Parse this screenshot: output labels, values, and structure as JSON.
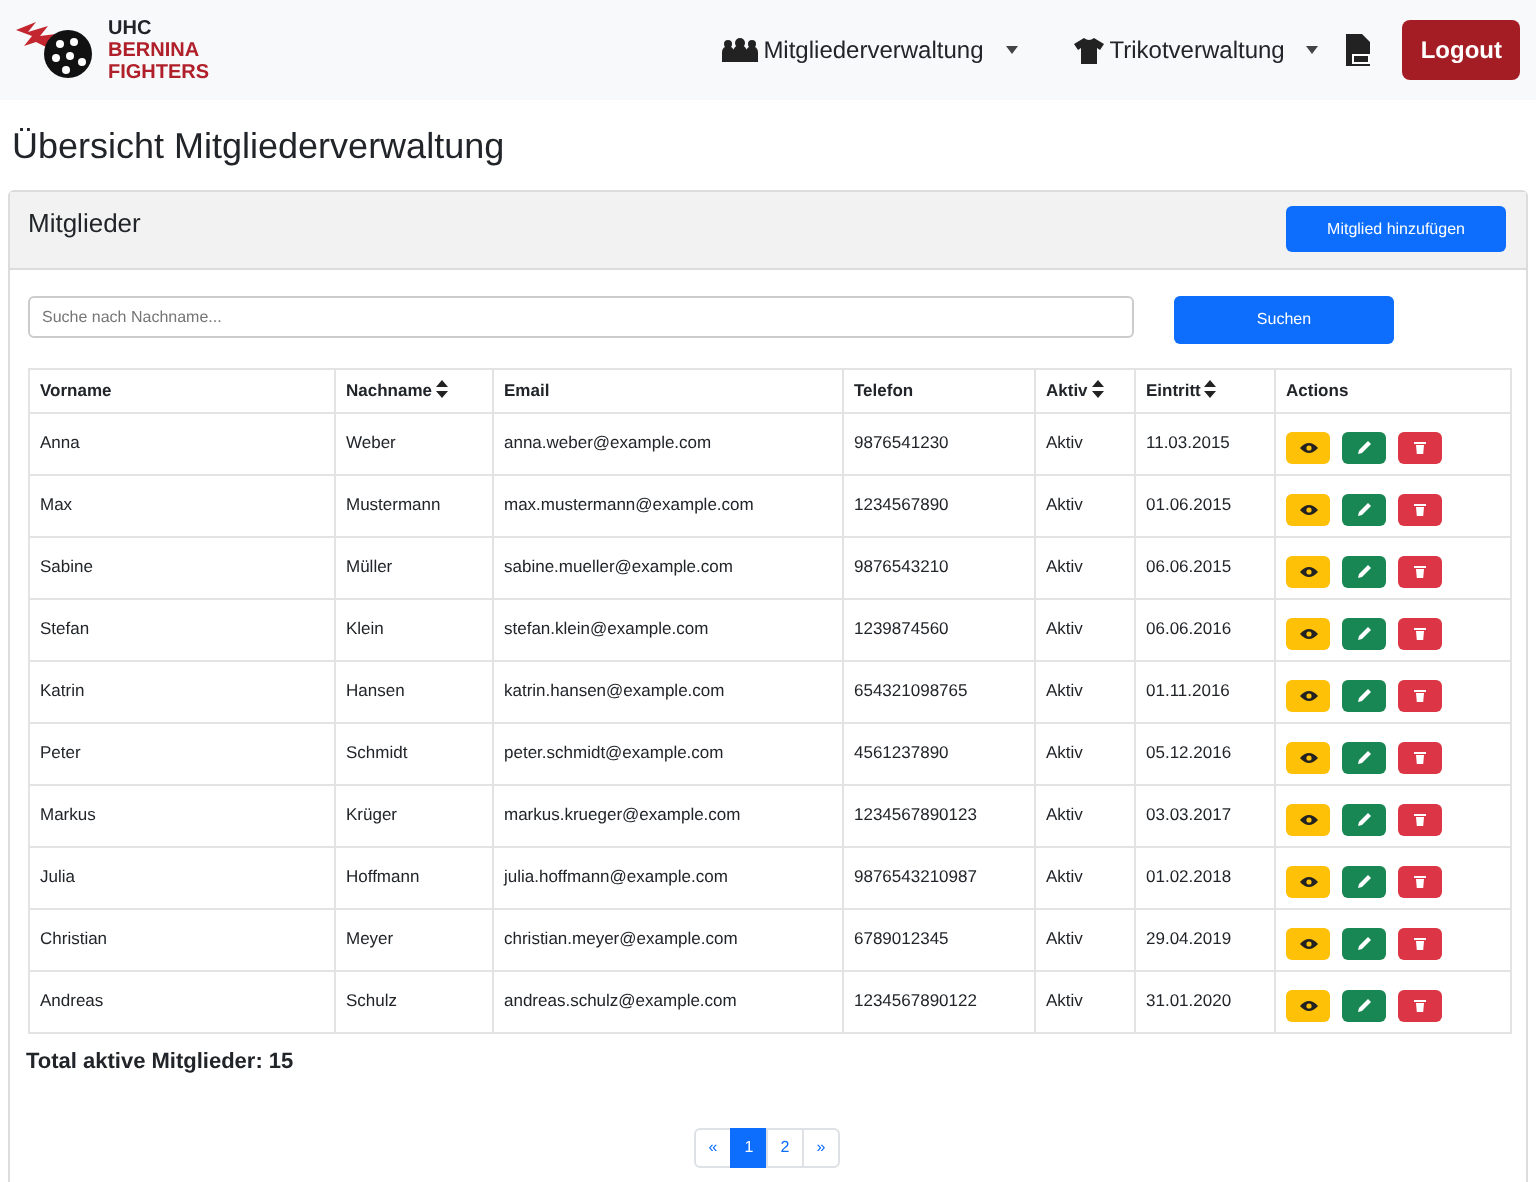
{
  "brand": {
    "line_1": "UHC",
    "line_2": "BERNINA",
    "line_3": "FIGHTERS"
  },
  "nav": [
    {
      "label": "Mitgliederverwaltung",
      "kind": "members"
    },
    {
      "label": "Trikotverwaltung",
      "kind": "shirt"
    }
  ],
  "logout": "Logout",
  "page_title": "Übersicht Mitgliederverwaltung",
  "card": {
    "title": "Mitglieder",
    "add_button": "Mitglied hinzufügen"
  },
  "search": {
    "placeholder": "Suche nach Nachname...",
    "button": "Suchen"
  },
  "table": {
    "columns": [
      {
        "label": "Vorname",
        "sortable": false
      },
      {
        "label": "Nachname",
        "sortable": true
      },
      {
        "label": "Email",
        "sortable": false
      },
      {
        "label": "Telefon",
        "sortable": false
      },
      {
        "label": "Aktiv",
        "sortable": true
      },
      {
        "label": "Eintritt",
        "sortable": true
      },
      {
        "label": "Actions",
        "sortable": false
      }
    ],
    "rows": [
      [
        "Anna",
        "Weber",
        "anna.weber@example.com",
        "9876541230",
        "Aktiv",
        "11.03.2015"
      ],
      [
        "Max",
        "Mustermann",
        "max.mustermann@example.com",
        "1234567890",
        "Aktiv",
        "01.06.2015"
      ],
      [
        "Sabine",
        "Müller",
        "sabine.mueller@example.com",
        "9876543210",
        "Aktiv",
        "06.06.2015"
      ],
      [
        "Stefan",
        "Klein",
        "stefan.klein@example.com",
        "1239874560",
        "Aktiv",
        "06.06.2016"
      ],
      [
        "Katrin",
        "Hansen",
        "katrin.hansen@example.com",
        "654321098765",
        "Aktiv",
        "01.11.2016"
      ],
      [
        "Peter",
        "Schmidt",
        "peter.schmidt@example.com",
        "4561237890",
        "Aktiv",
        "05.12.2016"
      ],
      [
        "Markus",
        "Krüger",
        "markus.krueger@example.com",
        "1234567890123",
        "Aktiv",
        "03.03.2017"
      ],
      [
        "Julia",
        "Hoffmann",
        "julia.hoffmann@example.com",
        "9876543210987",
        "Aktiv",
        "01.02.2018"
      ],
      [
        "Christian",
        "Meyer",
        "christian.meyer@example.com",
        "6789012345",
        "Aktiv",
        "29.04.2019"
      ],
      [
        "Andreas",
        "Schulz",
        "andreas.schulz@example.com",
        "1234567890122",
        "Aktiv",
        "31.01.2020"
      ]
    ]
  },
  "total": "Total aktive Mitglieder: 15",
  "pagination": [
    {
      "label": "«",
      "selected": false
    },
    {
      "label": "1",
      "selected": true
    },
    {
      "label": "2",
      "selected": false
    },
    {
      "label": "»",
      "selected": false
    }
  ]
}
